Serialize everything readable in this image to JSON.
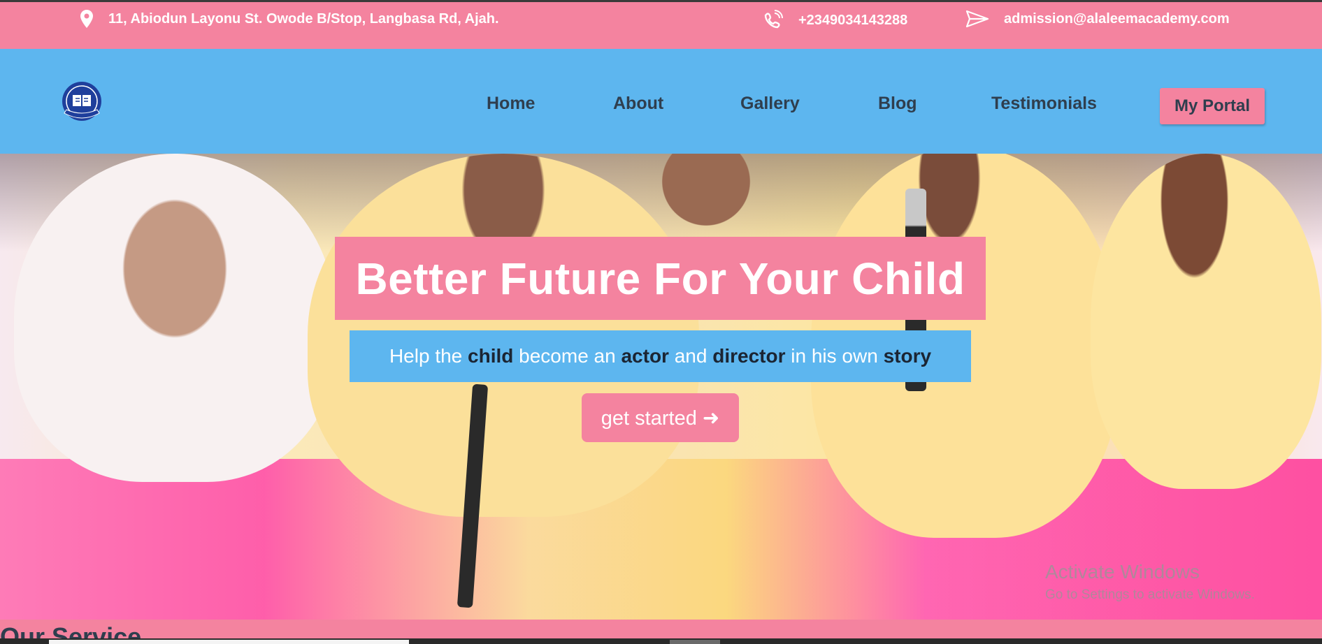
{
  "topbar": {
    "address": "11, Abiodun Layonu St. Owode B/Stop, Langbasa Rd, Ajah.",
    "phone": "+2349034143288",
    "email": "admission@alaleemacademy.com"
  },
  "nav": {
    "items": [
      "Home",
      "About",
      "Gallery",
      "Blog",
      "Testimonials"
    ],
    "portal_label": "My Portal"
  },
  "hero": {
    "headline": "Better Future For Your Child",
    "subtitle_parts": [
      "Help the ",
      "child",
      " become an ",
      "actor",
      " and ",
      "director",
      " in his own ",
      "story"
    ],
    "cta_label": "get started ➜"
  },
  "watermark": {
    "line1": "Activate Windows",
    "line2": "Go to Settings to activate Windows."
  },
  "section": {
    "title": "Our Service"
  },
  "colors": {
    "pink": "#f4839f",
    "blue": "#5db6ef",
    "dark_text": "#2f3e4e"
  },
  "icons": {
    "address": "map-pin-icon",
    "phone": "phone-icon",
    "email": "paper-plane-icon",
    "logo": "school-crest-logo"
  }
}
